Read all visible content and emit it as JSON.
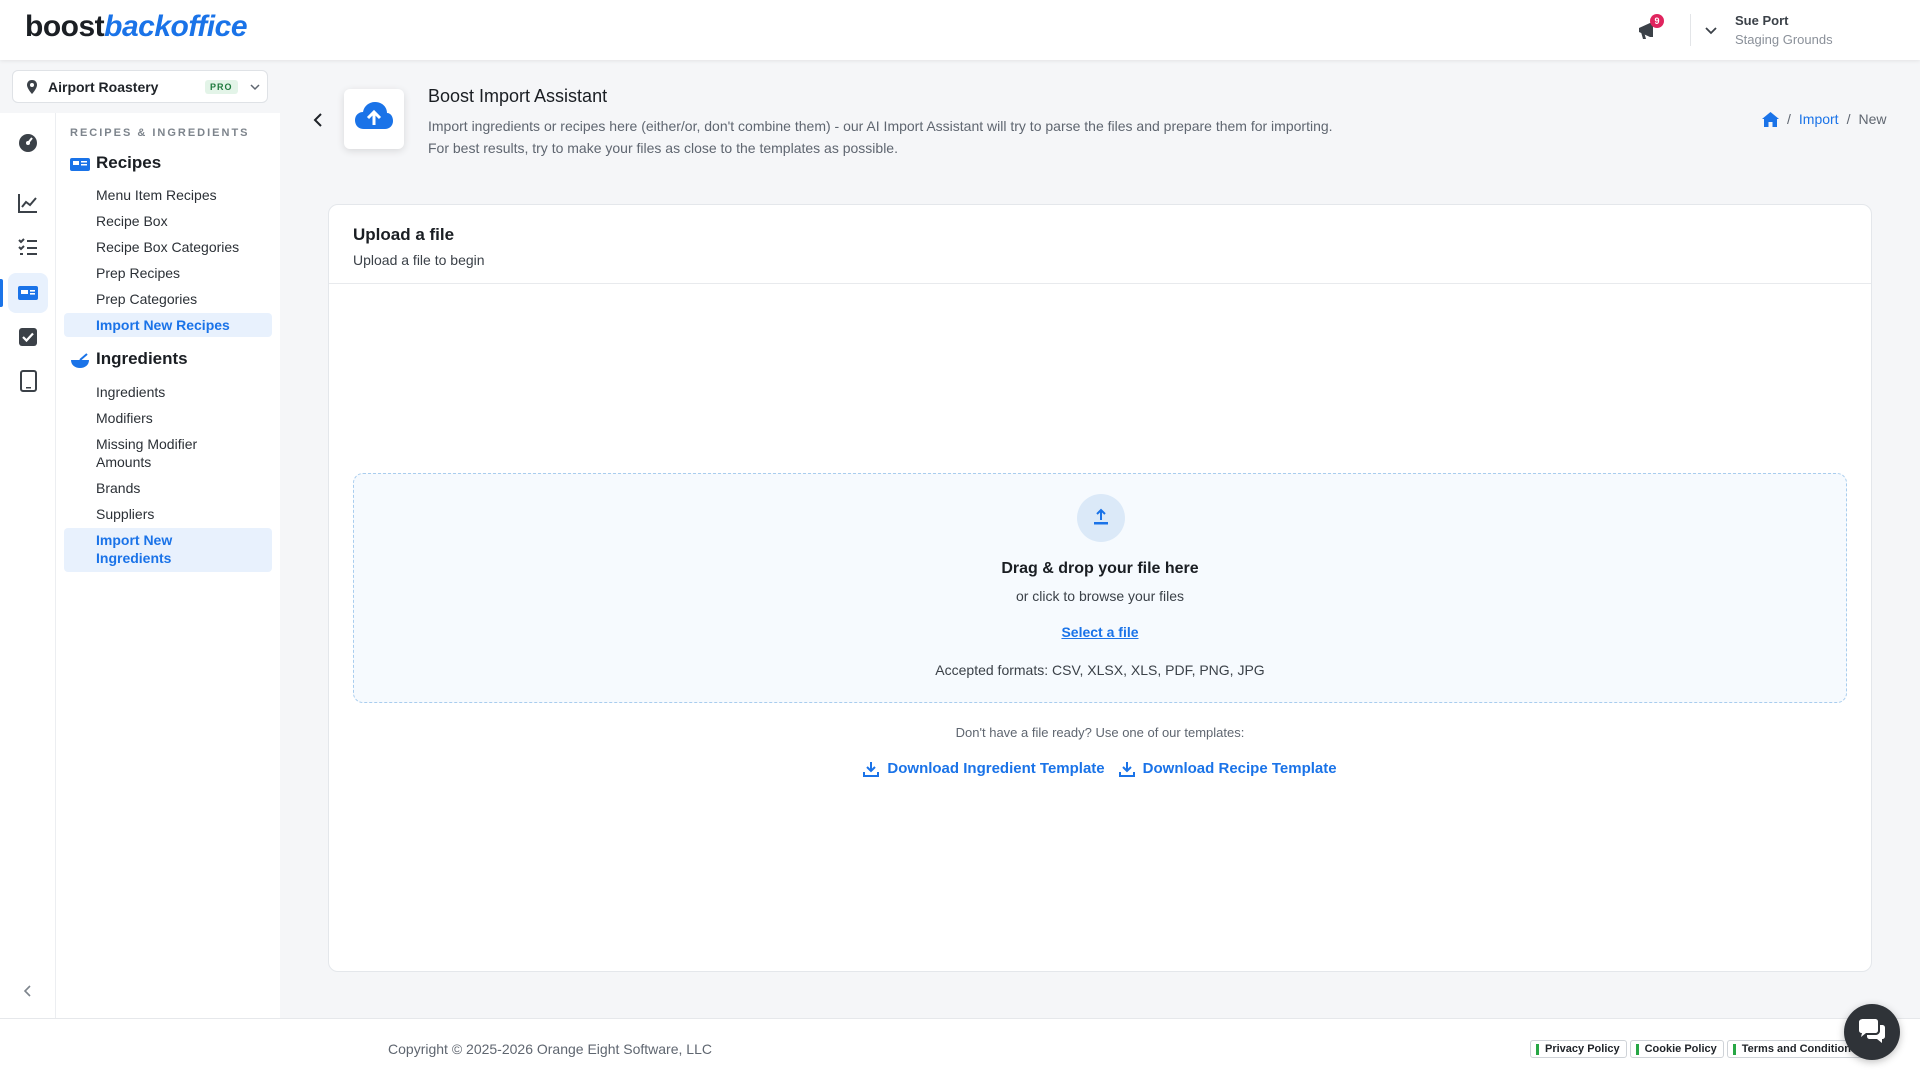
{
  "header": {
    "logo_primary": "boost",
    "logo_secondary": "backoffice",
    "notification_count": "9",
    "user_name": "Sue Port",
    "user_org": "Staging Grounds"
  },
  "location": {
    "name": "Airport Roastery",
    "badge": "PRO"
  },
  "rail": {
    "icons": [
      "dashboard-icon",
      "chart-line-icon",
      "checklist-icon",
      "recipe-card-icon",
      "checkbox-icon",
      "tablet-icon"
    ],
    "active_index": 3
  },
  "nav": {
    "heading": "RECIPES & INGREDIENTS",
    "recipes_group": "Recipes",
    "recipes_items": [
      "Menu Item Recipes",
      "Recipe Box",
      "Recipe Box Categories",
      "Prep Recipes",
      "Prep Categories",
      "Import New Recipes"
    ],
    "ingredients_group": "Ingredients",
    "ingredients_items": [
      "Ingredients",
      "Modifiers",
      "Missing Modifier Amounts",
      "Brands",
      "Suppliers",
      "Import New Ingredients"
    ]
  },
  "page": {
    "title": "Boost Import Assistant",
    "description_line1": "Import ingredients or recipes here (either/or, don't combine them) - our AI Import Assistant will try to parse the files and prepare them for importing.",
    "description_line2": "For best results, try to make your files as close to the templates as possible.",
    "breadcrumb": [
      "Import",
      "New"
    ]
  },
  "upload": {
    "title": "Upload a file",
    "subtitle": "Upload a file to begin",
    "drop_title": "Drag & drop your file here",
    "drop_sub": "or click to browse your files",
    "select_link": "Select a file",
    "formats": "Accepted formats: CSV, XLSX, XLS, PDF, PNG, JPG",
    "template_hint": "Don't have a file ready? Use one of our templates:",
    "download_ingredient": "Download Ingredient Template",
    "download_recipe": "Download Recipe Template"
  },
  "footer": {
    "copyright": "Copyright © 2025-2026 Orange Eight Software, LLC",
    "privacy": "Privacy Policy",
    "cookie": "Cookie Policy",
    "terms": "Terms and Conditions"
  },
  "colors": {
    "accent": "#1a73e8",
    "badge_red": "#e0245e",
    "pro_green": "#1f7a3e"
  }
}
